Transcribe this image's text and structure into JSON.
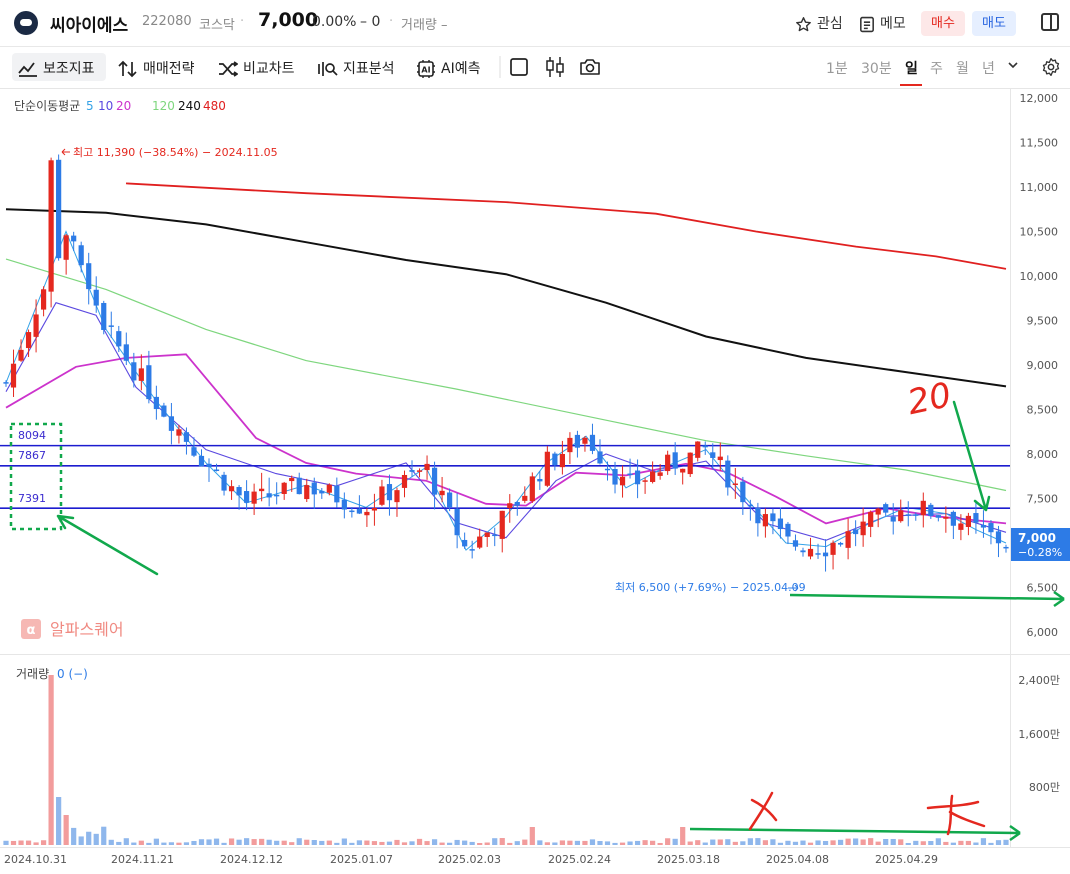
{
  "header": {
    "stock_name": "씨아이에스",
    "code": "222080",
    "market": "코스닥",
    "price": "7,000",
    "change_rate": "0.00%",
    "change": "– 0",
    "volume": "거래량 –",
    "watch_label": "관심",
    "memo_label": "메모",
    "buy_label": "매수",
    "sell_label": "매도"
  },
  "toolbar": {
    "items": [
      "보조지표",
      "매매전략",
      "비교차트",
      "지표분석",
      "AI예측"
    ],
    "periods": [
      "1분",
      "30분",
      "일",
      "주",
      "월",
      "년"
    ],
    "active_period": "일"
  },
  "legend": {
    "title": "단순이동평균",
    "ma_short": [
      "5",
      "10",
      "20"
    ],
    "ma_long": [
      "120",
      "240",
      "480"
    ],
    "colors": {
      "ma5": "#35a3e8",
      "ma10": "#5b49e0",
      "ma20": "#cc33cc",
      "ma120": "#7ed67e",
      "ma240": "#111111",
      "ma480": "#e02020"
    }
  },
  "annotations": {
    "high_label": "최고 11,390 (−38.54%) − 2024.11.05",
    "low_label": "최저 6,500 (+7.69%) − 2025.04.09",
    "levels": [
      "8094",
      "7867",
      "7391"
    ],
    "hand_number": "20",
    "watermark": "알파스퀘어"
  },
  "price_tag": {
    "price": "7,000",
    "change": "−0.28%"
  },
  "volume_panel": {
    "label": "거래량",
    "value": "0 (−)"
  },
  "colors": {
    "up": "#e4281f",
    "down": "#2d7be6",
    "vol_up": "#f29c9c",
    "vol_down": "#8fb7ec",
    "accent_green": "#11a84c",
    "level_line": "#1c1ccf"
  },
  "chart_data": {
    "type": "candlestick",
    "y_ticks": [
      "12,000",
      "11,500",
      "11,000",
      "10,500",
      "10,000",
      "9,500",
      "9,000",
      "8,500",
      "8,000",
      "7,500",
      "7,000",
      "6,500",
      "6,000"
    ],
    "ylim": [
      6000,
      12000
    ],
    "volume_ticks": [
      "2,400만",
      "1,600만",
      "800만"
    ],
    "x_ticks": [
      "2024.10.31",
      "2024.11.21",
      "2024.12.12",
      "2025.01.07",
      "2025.02.03",
      "2025.02.24",
      "2025.03.18",
      "2025.04.08",
      "2025.04.29"
    ],
    "horizontal_levels": [
      8094,
      7867,
      7391
    ],
    "ma240": [
      [
        0,
        10750
      ],
      [
        0.1,
        10710
      ],
      [
        0.2,
        10580
      ],
      [
        0.3,
        10380
      ],
      [
        0.4,
        10180
      ],
      [
        0.5,
        10020
      ],
      [
        0.6,
        9700
      ],
      [
        0.7,
        9320
      ],
      [
        0.8,
        9080
      ],
      [
        0.9,
        8920
      ],
      [
        1.0,
        8760
      ]
    ],
    "ma480": [
      [
        0.12,
        11040
      ],
      [
        0.3,
        10930
      ],
      [
        0.5,
        10830
      ],
      [
        0.65,
        10700
      ],
      [
        0.75,
        10500
      ],
      [
        0.85,
        10330
      ],
      [
        0.93,
        10220
      ],
      [
        1.0,
        10080
      ]
    ],
    "ma120": [
      [
        0,
        10190
      ],
      [
        0.1,
        9850
      ],
      [
        0.2,
        9400
      ],
      [
        0.3,
        9050
      ],
      [
        0.45,
        8730
      ],
      [
        0.6,
        8380
      ],
      [
        0.7,
        8150
      ],
      [
        0.8,
        7980
      ],
      [
        0.9,
        7820
      ],
      [
        1.0,
        7590
      ]
    ],
    "ma20": [
      [
        0,
        8520
      ],
      [
        0.07,
        8980
      ],
      [
        0.12,
        9080
      ],
      [
        0.18,
        9120
      ],
      [
        0.25,
        8180
      ],
      [
        0.3,
        7900
      ],
      [
        0.35,
        7780
      ],
      [
        0.42,
        7700
      ],
      [
        0.48,
        7440
      ],
      [
        0.52,
        7420
      ],
      [
        0.57,
        7790
      ],
      [
        0.62,
        7760
      ],
      [
        0.68,
        7890
      ],
      [
        0.72,
        7800
      ],
      [
        0.77,
        7520
      ],
      [
        0.82,
        7220
      ],
      [
        0.88,
        7390
      ],
      [
        0.93,
        7300
      ],
      [
        1.0,
        7220
      ]
    ],
    "ma10": [
      [
        0,
        8700
      ],
      [
        0.05,
        9700
      ],
      [
        0.09,
        9560
      ],
      [
        0.13,
        8750
      ],
      [
        0.2,
        8050
      ],
      [
        0.27,
        7780
      ],
      [
        0.33,
        7640
      ],
      [
        0.4,
        7900
      ],
      [
        0.45,
        7230
      ],
      [
        0.5,
        7060
      ],
      [
        0.55,
        7700
      ],
      [
        0.6,
        8000
      ],
      [
        0.65,
        7800
      ],
      [
        0.7,
        7920
      ],
      [
        0.76,
        7220
      ],
      [
        0.82,
        7030
      ],
      [
        0.88,
        7300
      ],
      [
        0.94,
        7330
      ],
      [
        1.0,
        7120
      ]
    ],
    "ma5": [
      [
        0,
        8800
      ],
      [
        0.06,
        10500
      ],
      [
        0.1,
        9400
      ],
      [
        0.15,
        8600
      ],
      [
        0.2,
        7900
      ],
      [
        0.24,
        7450
      ],
      [
        0.3,
        7650
      ],
      [
        0.36,
        7400
      ],
      [
        0.42,
        7850
      ],
      [
        0.46,
        6920
      ],
      [
        0.5,
        7300
      ],
      [
        0.54,
        7900
      ],
      [
        0.58,
        8200
      ],
      [
        0.62,
        7620
      ],
      [
        0.66,
        7860
      ],
      [
        0.7,
        8050
      ],
      [
        0.74,
        7500
      ],
      [
        0.78,
        7000
      ],
      [
        0.82,
        6960
      ],
      [
        0.86,
        7200
      ],
      [
        0.9,
        7400
      ],
      [
        0.94,
        7330
      ],
      [
        0.97,
        7150
      ],
      [
        1.0,
        7000
      ]
    ]
  }
}
